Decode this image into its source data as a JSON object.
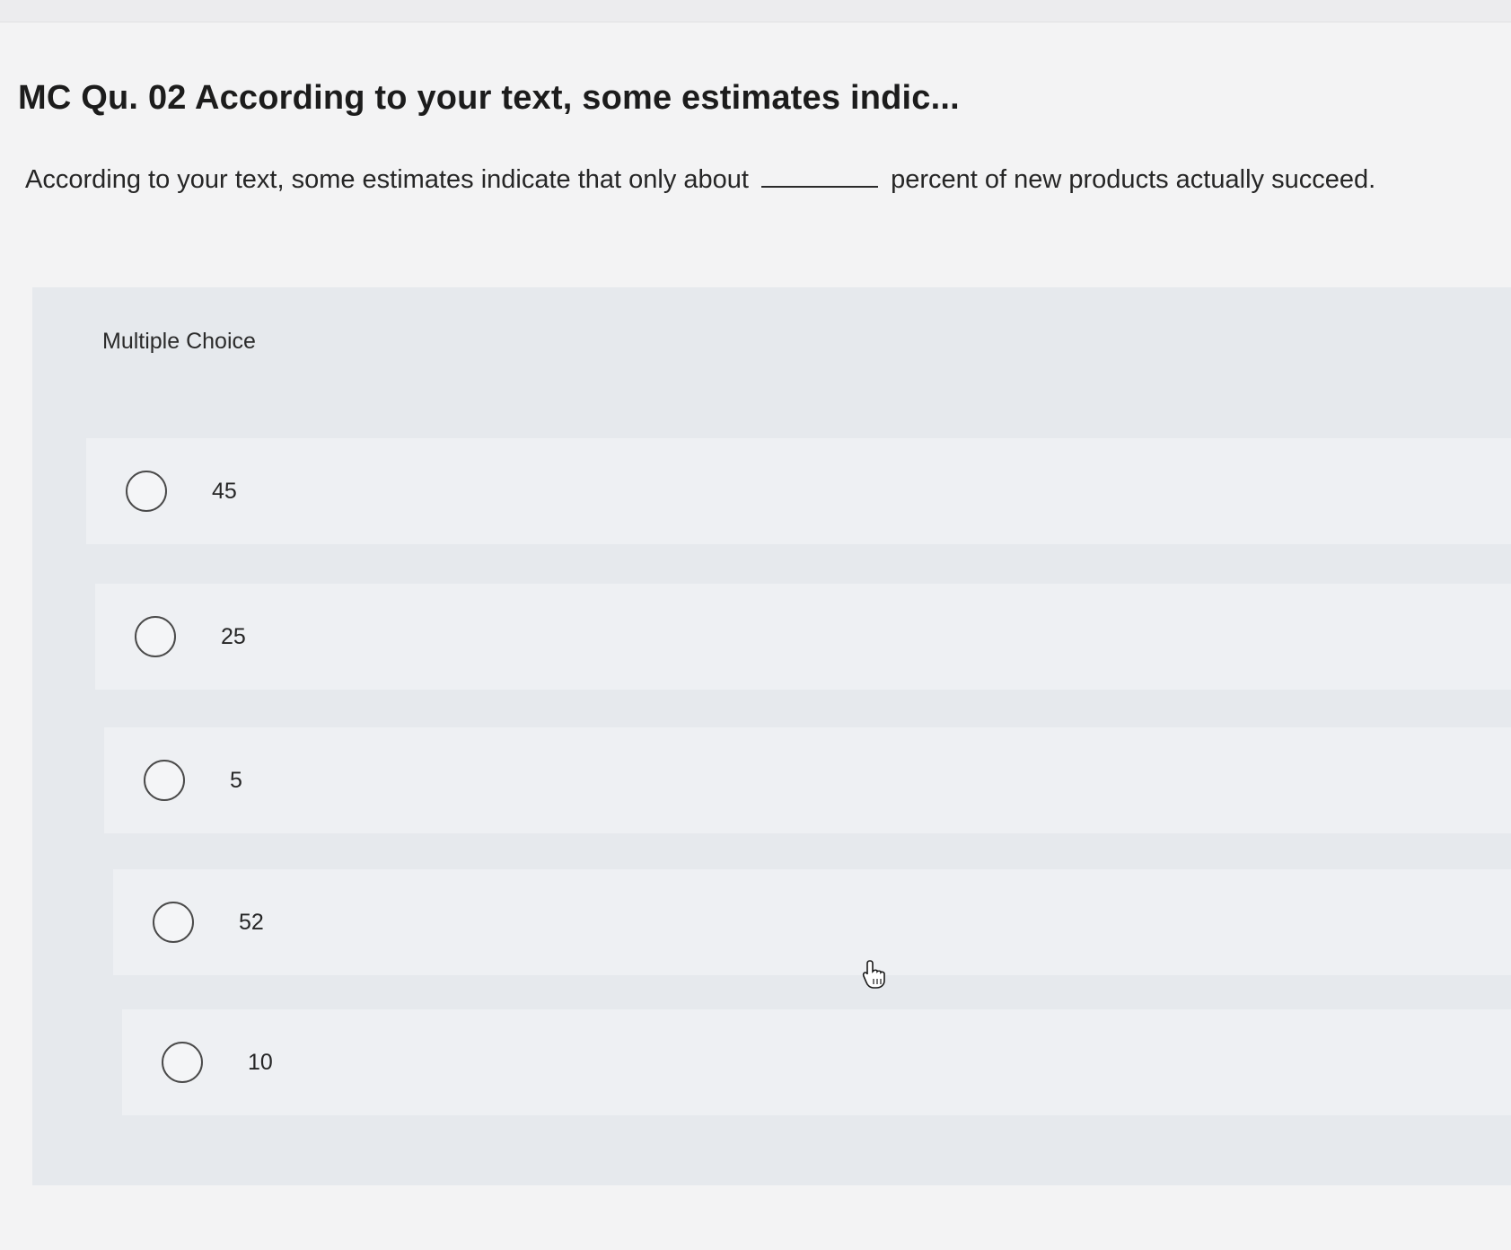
{
  "question": {
    "title": "MC Qu. 02 According to your text, some estimates indic...",
    "text_before_blank": "According to your text, some estimates indicate that only about",
    "text_after_blank": "percent of new products actually succeed."
  },
  "multiple_choice": {
    "label": "Multiple Choice",
    "options": [
      {
        "label": "45",
        "selected": false
      },
      {
        "label": "25",
        "selected": false
      },
      {
        "label": "5",
        "selected": false
      },
      {
        "label": "52",
        "selected": false
      },
      {
        "label": "10",
        "selected": false
      }
    ]
  },
  "cursor": {
    "icon": "hand-pointer-icon"
  }
}
